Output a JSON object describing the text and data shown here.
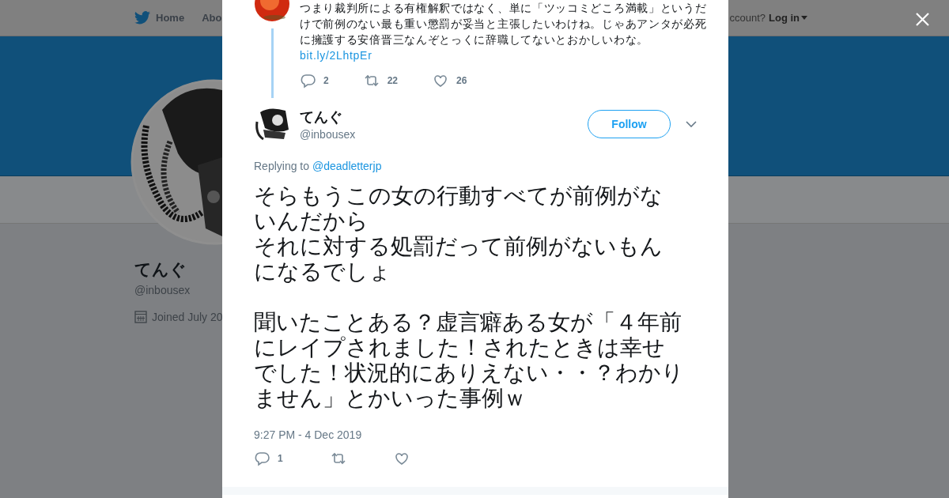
{
  "background_page": {
    "nav": {
      "items": [
        {
          "label": "Home",
          "kind": "home"
        },
        {
          "label": "Abo",
          "kind": "plain"
        }
      ],
      "account_prompt": "ccount?",
      "login": "Log in"
    },
    "profile": {
      "name": "てんぐ",
      "handle": "@inbousex",
      "joined": "Joined July 20"
    }
  },
  "tweets": [
    {
      "kind": "parent",
      "text": "つまり裁判所による有権解釈ではなく、単に「ツッコミどころ満載」というだけで前例のない最も重い懲罰が妥当と主張したいわけね。じゃあアンタが必死に擁護する安倍晋三なんぞとっくに辞職してないとおかしいわな。",
      "link": "bit.ly/2LhtpEr",
      "actions": [
        {
          "kind": "reply",
          "count": "2"
        },
        {
          "kind": "retweet",
          "count": "22"
        },
        {
          "kind": "like",
          "count": "26"
        }
      ]
    },
    {
      "kind": "main",
      "name": "てんぐ",
      "handle": "@inbousex",
      "follow": "Follow",
      "replying_label": "Replying to",
      "reply_to": "@deadletterjp",
      "paragraphs": [
        [
          "そらもうこの女の行動すべてが前例がないんだから",
          "それに対する処罰だって前例がないもんになるでしょ"
        ],
        [
          "聞いたことある？虚言癖ある女が「４年前にレイプされました！されたときは幸せでした！状況的にありえない・・？わかりません」とかいった事例ｗ"
        ]
      ],
      "timestamp": "9:27 PM - 4 Dec 2019",
      "actions": [
        {
          "kind": "reply",
          "count": "1"
        },
        {
          "kind": "retweet"
        },
        {
          "kind": "like"
        }
      ]
    }
  ]
}
